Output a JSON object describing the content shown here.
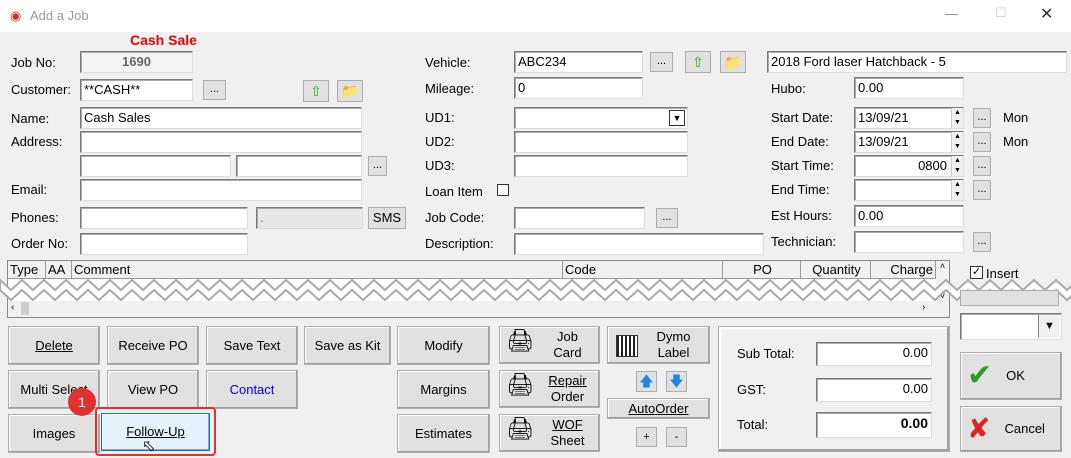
{
  "window": {
    "title": "Add a Job",
    "banner": "Cash Sale"
  },
  "left": {
    "job_no_label": "Job No:",
    "job_no": "1690",
    "customer_label": "Customer:",
    "customer": "**CASH**",
    "name_label": "Name:",
    "name": "Cash Sales",
    "address_label": "Address:",
    "email_label": "Email:",
    "phones_label": "Phones:",
    "sms": "SMS",
    "order_no_label": "Order No:",
    "ellipsis": "..."
  },
  "middle": {
    "vehicle_label": "Vehicle:",
    "vehicle": "ABC234",
    "mileage_label": "Mileage:",
    "mileage": "0",
    "ud1_label": "UD1:",
    "ud2_label": "UD2:",
    "ud3_label": "UD3:",
    "loan_label": "Loan Item",
    "job_code_label": "Job Code:",
    "description_label": "Description:"
  },
  "right": {
    "vehicle_desc": "2018 Ford laser Hatchback - 5",
    "hubo_label": "Hubo:",
    "hubo": "0.00",
    "start_date_label": "Start Date:",
    "start_date": "13/09/21",
    "start_day": "Mon",
    "end_date_label": "End Date:",
    "end_date": "13/09/21",
    "end_day": "Mon",
    "start_time_label": "Start Time:",
    "start_time": "0800",
    "end_time_label": "End Time:",
    "est_hours_label": "Est Hours:",
    "est_hours": "0.00",
    "technician_label": "Technician:"
  },
  "grid": {
    "columns": [
      "Type",
      "AA",
      "Comment",
      "Code",
      "PO",
      "Quantity",
      "Charge"
    ]
  },
  "side": {
    "insert": "Insert",
    "ok": "OK",
    "cancel": "Cancel"
  },
  "buttons": {
    "delete": "Delete",
    "receive_po": "Receive PO",
    "save_text": "Save Text",
    "save_as_kit": "Save as Kit",
    "modify": "Modify",
    "multi_select": "Multi Select",
    "view_po": "View PO",
    "contact": "Contact",
    "margins": "Margins",
    "images": "Images",
    "follow_up": "Follow-Up",
    "estimates": "Estimates",
    "job_card": [
      "Job",
      "Card"
    ],
    "repair_order": [
      "Repair",
      "Order"
    ],
    "wof_sheet": [
      "WOF",
      "Sheet"
    ],
    "dymo": [
      "Dymo",
      "Label"
    ],
    "autoorder": "AutoOrder",
    "plus": "+",
    "minus": "-"
  },
  "totals": {
    "sub_total_label": "Sub Total:",
    "sub_total": "0.00",
    "gst_label": "GST:",
    "gst": "0.00",
    "total_label": "Total:",
    "total": "0.00"
  },
  "badge": "1"
}
